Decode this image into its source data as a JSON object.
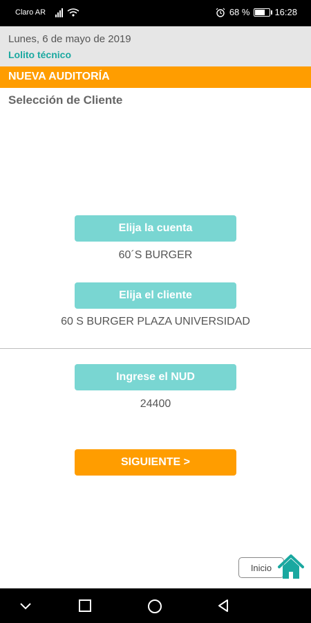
{
  "status_bar": {
    "carrier": "Claro AR",
    "battery": "68 %",
    "time": "16:28"
  },
  "header": {
    "date": "Lunes, 6 de mayo de 2019",
    "user": "Lolito técnico"
  },
  "banner": {
    "title": "NUEVA AUDITORÍA"
  },
  "subtitle": "Selección de Cliente",
  "account": {
    "button": "Elija la cuenta",
    "value": "60´S BURGER"
  },
  "client": {
    "button": "Elija el cliente",
    "value": "60 S BURGER PLAZA UNIVERSIDAD"
  },
  "nud": {
    "button": "Ingrese el NUD",
    "value": "24400"
  },
  "next_button": "SIGUIENTE >",
  "home": {
    "label": "Inicio"
  },
  "colors": {
    "accent_orange": "#ff9d00",
    "teal": "#79d6d2",
    "teal_text": "#1aa8a0"
  }
}
